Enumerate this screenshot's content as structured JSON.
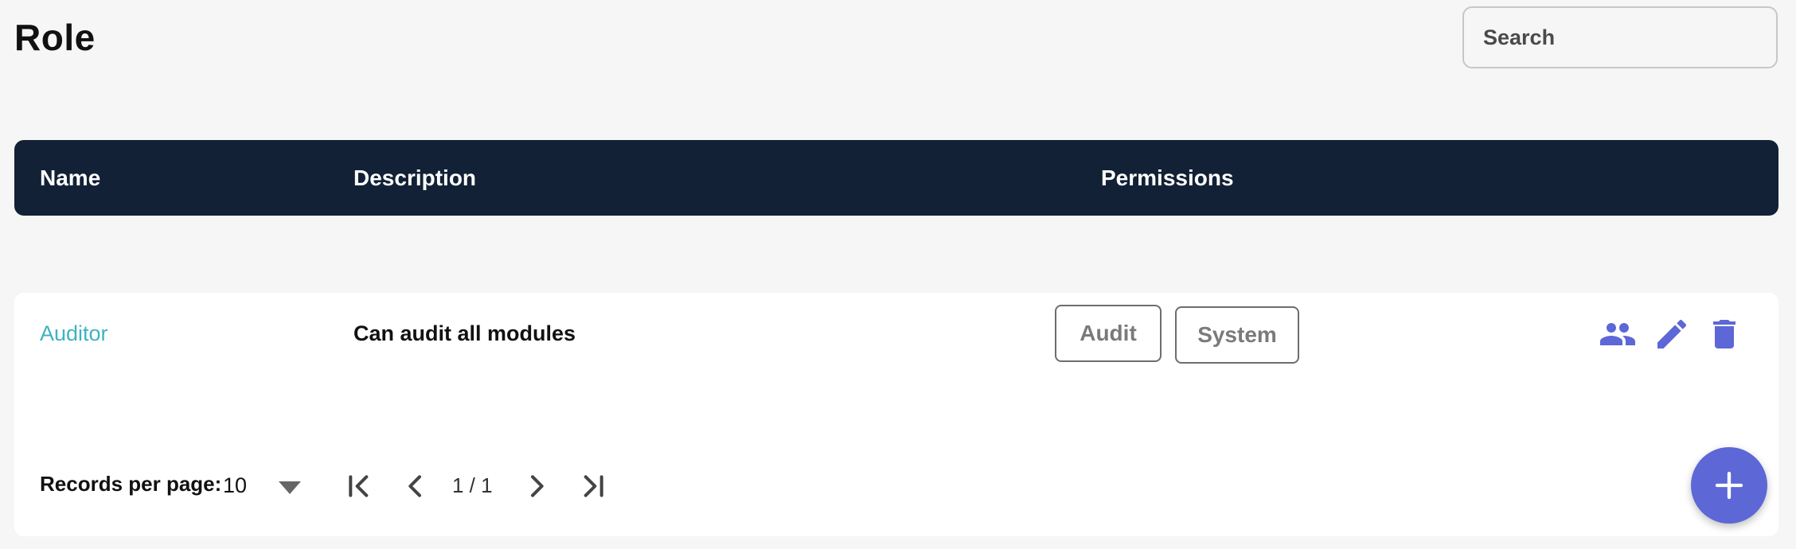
{
  "page": {
    "title": "Role"
  },
  "search": {
    "placeholder": "Search",
    "value": ""
  },
  "table": {
    "columns": [
      "Name",
      "Description",
      "Permissions"
    ],
    "rows": [
      {
        "name": "Auditor",
        "description": "Can audit all modules",
        "permissions": [
          "Audit",
          "System"
        ],
        "actions": [
          "people-icon",
          "edit-icon",
          "delete-icon"
        ]
      }
    ]
  },
  "pagination": {
    "records_label": "Records per page:",
    "records_per_page": "10",
    "page_indicator": "1 / 1"
  },
  "colors": {
    "header_bg": "#122135",
    "accent": "#5d67d6",
    "link": "#3fb3bf"
  },
  "fab": {
    "icon": "plus-icon"
  }
}
